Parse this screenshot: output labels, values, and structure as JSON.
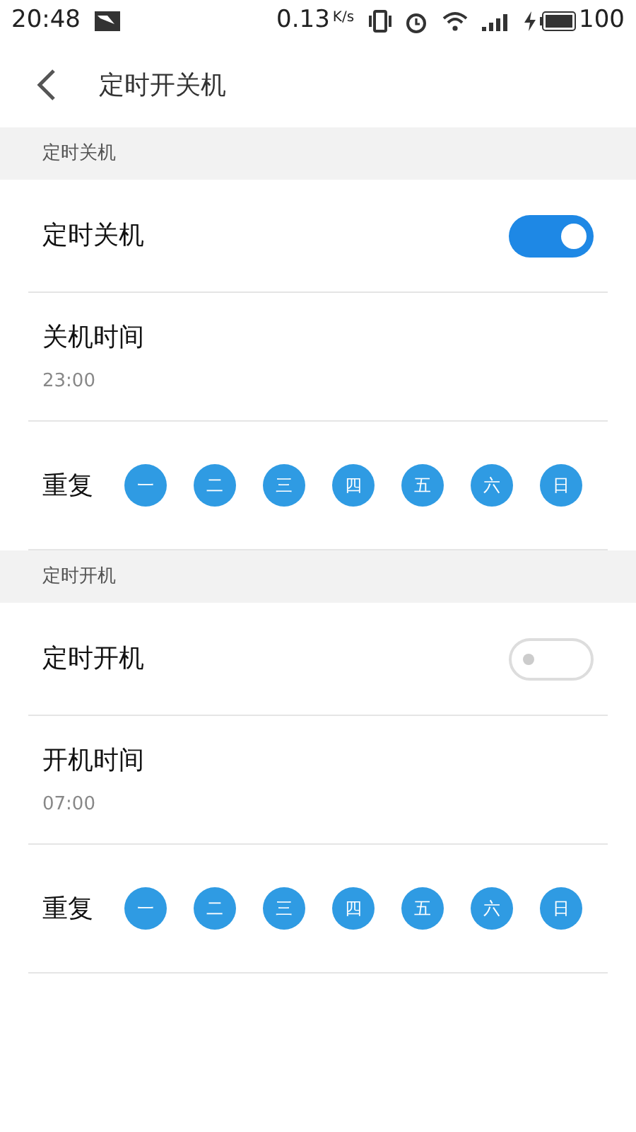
{
  "status_bar": {
    "time": "20:48",
    "speed": "0.13",
    "speed_unit": "K/s",
    "battery": "100"
  },
  "header": {
    "title": "定时开关机"
  },
  "sections": [
    {
      "title": "定时关机",
      "toggle": {
        "label": "定时关机",
        "on": true
      },
      "time": {
        "label": "关机时间",
        "value": "23:00"
      },
      "repeat": {
        "label": "重复",
        "days": [
          {
            "label": "一",
            "selected": true
          },
          {
            "label": "二",
            "selected": true
          },
          {
            "label": "三",
            "selected": true
          },
          {
            "label": "四",
            "selected": true
          },
          {
            "label": "五",
            "selected": true
          },
          {
            "label": "六",
            "selected": true
          },
          {
            "label": "日",
            "selected": true
          }
        ]
      }
    },
    {
      "title": "定时开机",
      "toggle": {
        "label": "定时开机",
        "on": false
      },
      "time": {
        "label": "开机时间",
        "value": "07:00"
      },
      "repeat": {
        "label": "重复",
        "days": [
          {
            "label": "一",
            "selected": true
          },
          {
            "label": "二",
            "selected": true
          },
          {
            "label": "三",
            "selected": true
          },
          {
            "label": "四",
            "selected": true
          },
          {
            "label": "五",
            "selected": true
          },
          {
            "label": "六",
            "selected": true
          },
          {
            "label": "日",
            "selected": true
          }
        ]
      }
    }
  ]
}
